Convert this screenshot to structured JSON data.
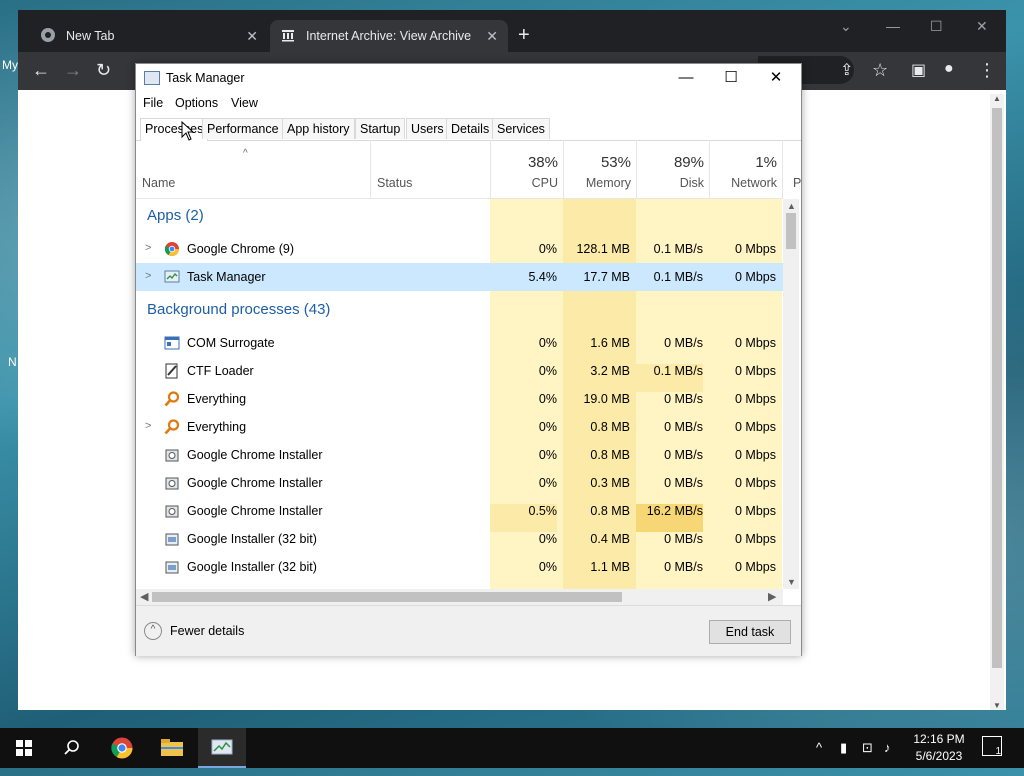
{
  "desktop": {
    "fragment_my": "My",
    "fragment_n": "N"
  },
  "chrome": {
    "tabs": [
      {
        "label": "New Tab",
        "icon": "chrome-icon",
        "close": "✕"
      },
      {
        "label": "Internet Archive: View Archive",
        "icon": "archive-icon",
        "close": "✕"
      }
    ],
    "new_tab": "+",
    "window_controls": [
      "⌄",
      "—",
      "☐",
      "✕"
    ],
    "omnibox_tail": "M...",
    "toolbar_icons": [
      "arrow-left-icon",
      "arrow-right-icon",
      "reload-icon",
      "share-icon",
      "star-icon",
      "sidebar-icon",
      "profile-icon",
      "menu-icon"
    ]
  },
  "task_manager": {
    "title": "Task Manager",
    "window_buttons": {
      "minimize": "—",
      "maximize": "☐",
      "close": "✕"
    },
    "menu": [
      "File",
      "Options",
      "View"
    ],
    "tabs": [
      "Processes",
      "Performance",
      "App history",
      "Startup",
      "Users",
      "Details",
      "Services"
    ],
    "active_tab": "Processes",
    "columns": {
      "name": "Name",
      "status": "Status",
      "cpu": {
        "pct": "38%",
        "label": "CPU"
      },
      "memory": {
        "pct": "53%",
        "label": "Memory"
      },
      "disk": {
        "pct": "89%",
        "label": "Disk"
      },
      "network": {
        "pct": "1%",
        "label": "Network"
      },
      "power_partial": "P"
    },
    "groups": {
      "apps": "Apps (2)",
      "background": "Background processes (43)"
    },
    "apps": [
      {
        "name": "Google Chrome (9)",
        "icon": "chrome-icon",
        "expandable": true,
        "cpu": "0%",
        "memory": "128.1 MB",
        "disk": "0.1 MB/s",
        "network": "0 Mbps"
      },
      {
        "name": "Task Manager",
        "icon": "task-manager-icon",
        "expandable": true,
        "cpu": "5.4%",
        "memory": "17.7 MB",
        "disk": "0.1 MB/s",
        "network": "0 Mbps"
      }
    ],
    "background": [
      {
        "name": "COM Surrogate",
        "icon": "com-surrogate-icon",
        "expandable": false,
        "cpu": "0%",
        "memory": "1.6 MB",
        "disk": "0 MB/s",
        "network": "0 Mbps"
      },
      {
        "name": "CTF Loader",
        "icon": "ctf-loader-icon",
        "expandable": false,
        "cpu": "0%",
        "memory": "3.2 MB",
        "disk": "0.1 MB/s",
        "network": "0 Mbps"
      },
      {
        "name": "Everything",
        "icon": "everything-icon",
        "expandable": false,
        "cpu": "0%",
        "memory": "19.0 MB",
        "disk": "0 MB/s",
        "network": "0 Mbps"
      },
      {
        "name": "Everything",
        "icon": "everything-icon",
        "expandable": true,
        "cpu": "0%",
        "memory": "0.8 MB",
        "disk": "0 MB/s",
        "network": "0 Mbps"
      },
      {
        "name": "Google Chrome Installer",
        "icon": "installer-icon",
        "expandable": false,
        "cpu": "0%",
        "memory": "0.8 MB",
        "disk": "0 MB/s",
        "network": "0 Mbps"
      },
      {
        "name": "Google Chrome Installer",
        "icon": "installer-icon",
        "expandable": false,
        "cpu": "0%",
        "memory": "0.3 MB",
        "disk": "0 MB/s",
        "network": "0 Mbps"
      },
      {
        "name": "Google Chrome Installer",
        "icon": "installer-icon",
        "expandable": false,
        "cpu": "0.5%",
        "memory": "0.8 MB",
        "disk": "16.2 MB/s",
        "network": "0 Mbps"
      },
      {
        "name": "Google Installer (32 bit)",
        "icon": "google-installer-icon",
        "expandable": false,
        "cpu": "0%",
        "memory": "0.4 MB",
        "disk": "0 MB/s",
        "network": "0 Mbps"
      },
      {
        "name": "Google Installer (32 bit)",
        "icon": "google-installer-icon",
        "expandable": false,
        "cpu": "0%",
        "memory": "1.1 MB",
        "disk": "0 MB/s",
        "network": "0 Mbps"
      }
    ],
    "footer": {
      "fewer_details": "Fewer details",
      "end_task": "End task"
    },
    "colors": {
      "heat_light": "#fff4c4",
      "heat_mid": "#fbe9a6",
      "heat_high": "#f9e08a",
      "selected": "#cce8ff",
      "group_text": "#1d5fa7"
    }
  },
  "taskbar": {
    "items": [
      "windows-start-icon",
      "search-icon",
      "chrome-icon",
      "file-explorer-icon",
      "task-manager-icon"
    ],
    "tray": [
      "chevron-up-icon",
      "battery-icon",
      "network-icon",
      "volume-icon"
    ],
    "time": "12:16 PM",
    "date": "5/6/2023",
    "notifications": "1"
  }
}
